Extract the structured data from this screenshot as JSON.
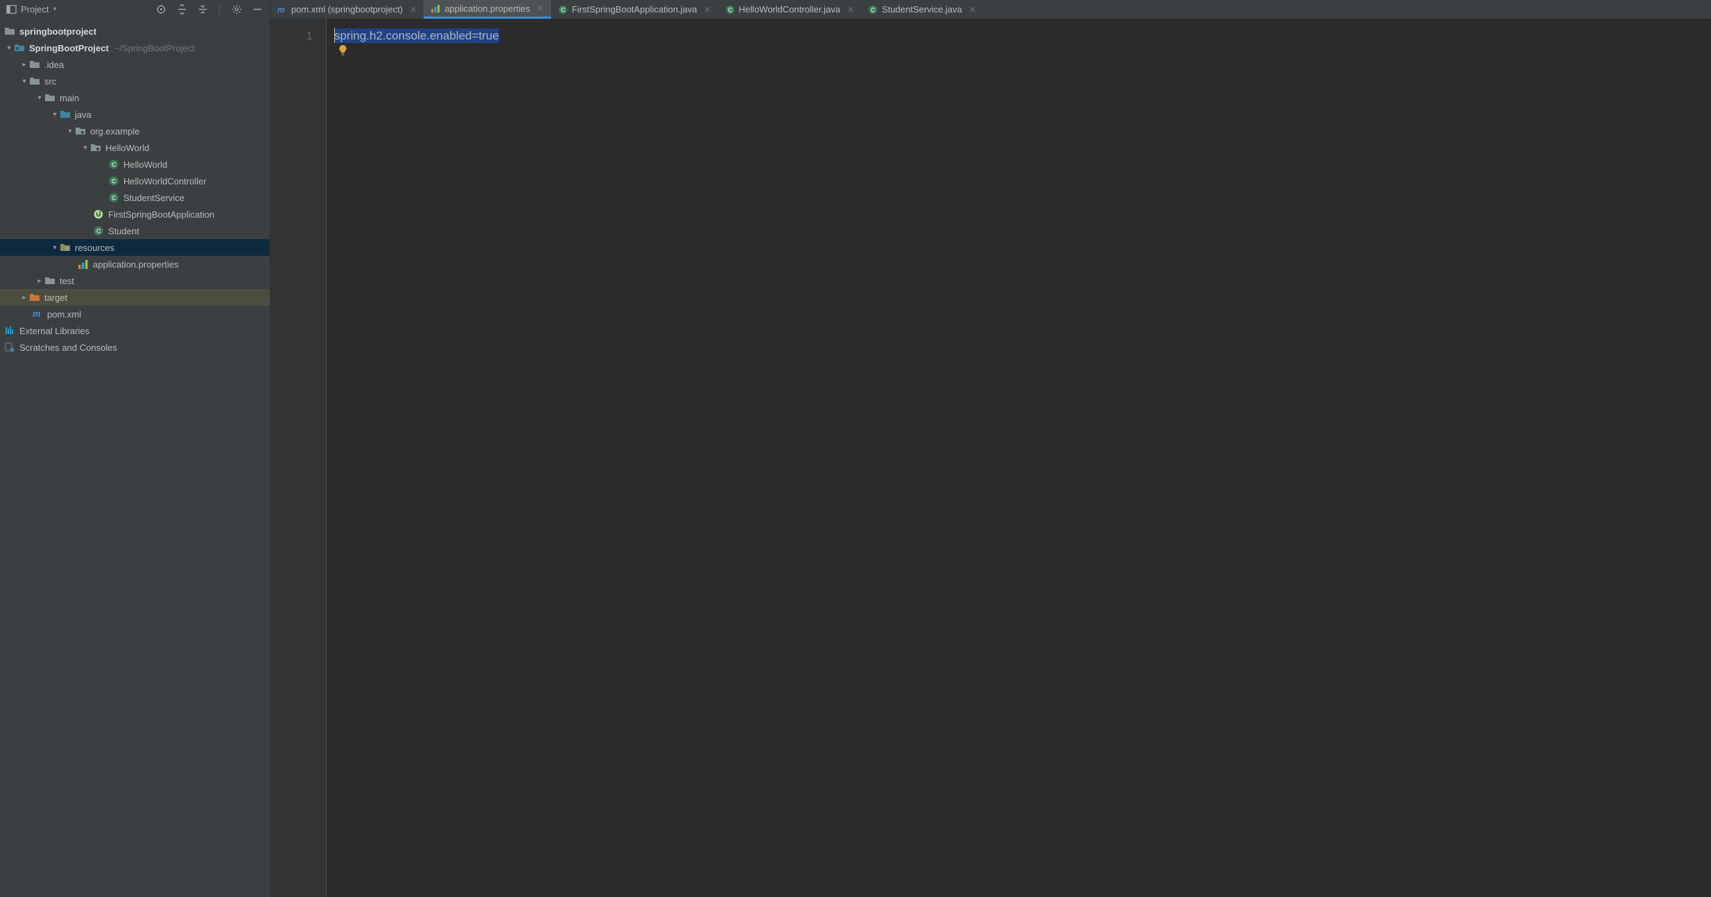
{
  "toolWindow": {
    "title": "Project"
  },
  "tabs": [
    {
      "label": "pom.xml (springbootproject)",
      "icon": "pom",
      "active": false
    },
    {
      "label": "application.properties",
      "icon": "props",
      "active": true
    },
    {
      "label": "FirstSpringBootApplication.java",
      "icon": "class",
      "active": false
    },
    {
      "label": "HelloWorldController.java",
      "icon": "class",
      "active": false
    },
    {
      "label": "StudentService.java",
      "icon": "class",
      "active": false
    }
  ],
  "tree": {
    "root": {
      "label": "springbootproject"
    },
    "module": {
      "label": "SpringBootProject",
      "hint": "~/SpringBootProject"
    },
    "idea": {
      "label": ".idea"
    },
    "src": {
      "label": "src"
    },
    "main": {
      "label": "main"
    },
    "java": {
      "label": "java"
    },
    "pkg": {
      "label": "org.example"
    },
    "hwpkg": {
      "label": "HelloWorld"
    },
    "hw": {
      "label": "HelloWorld"
    },
    "hwc": {
      "label": "HelloWorldController"
    },
    "ss": {
      "label": "StudentService"
    },
    "app": {
      "label": "FirstSpringBootApplication"
    },
    "student": {
      "label": "Student"
    },
    "resources": {
      "label": "resources"
    },
    "appprops": {
      "label": "application.properties"
    },
    "test": {
      "label": "test"
    },
    "target": {
      "label": "target"
    },
    "pom": {
      "label": "pom.xml"
    },
    "extlib": {
      "label": "External Libraries"
    },
    "scratch": {
      "label": "Scratches and Consoles"
    }
  },
  "editor": {
    "lineNumber": "1",
    "code": "spring.h2.console.enabled=true"
  }
}
